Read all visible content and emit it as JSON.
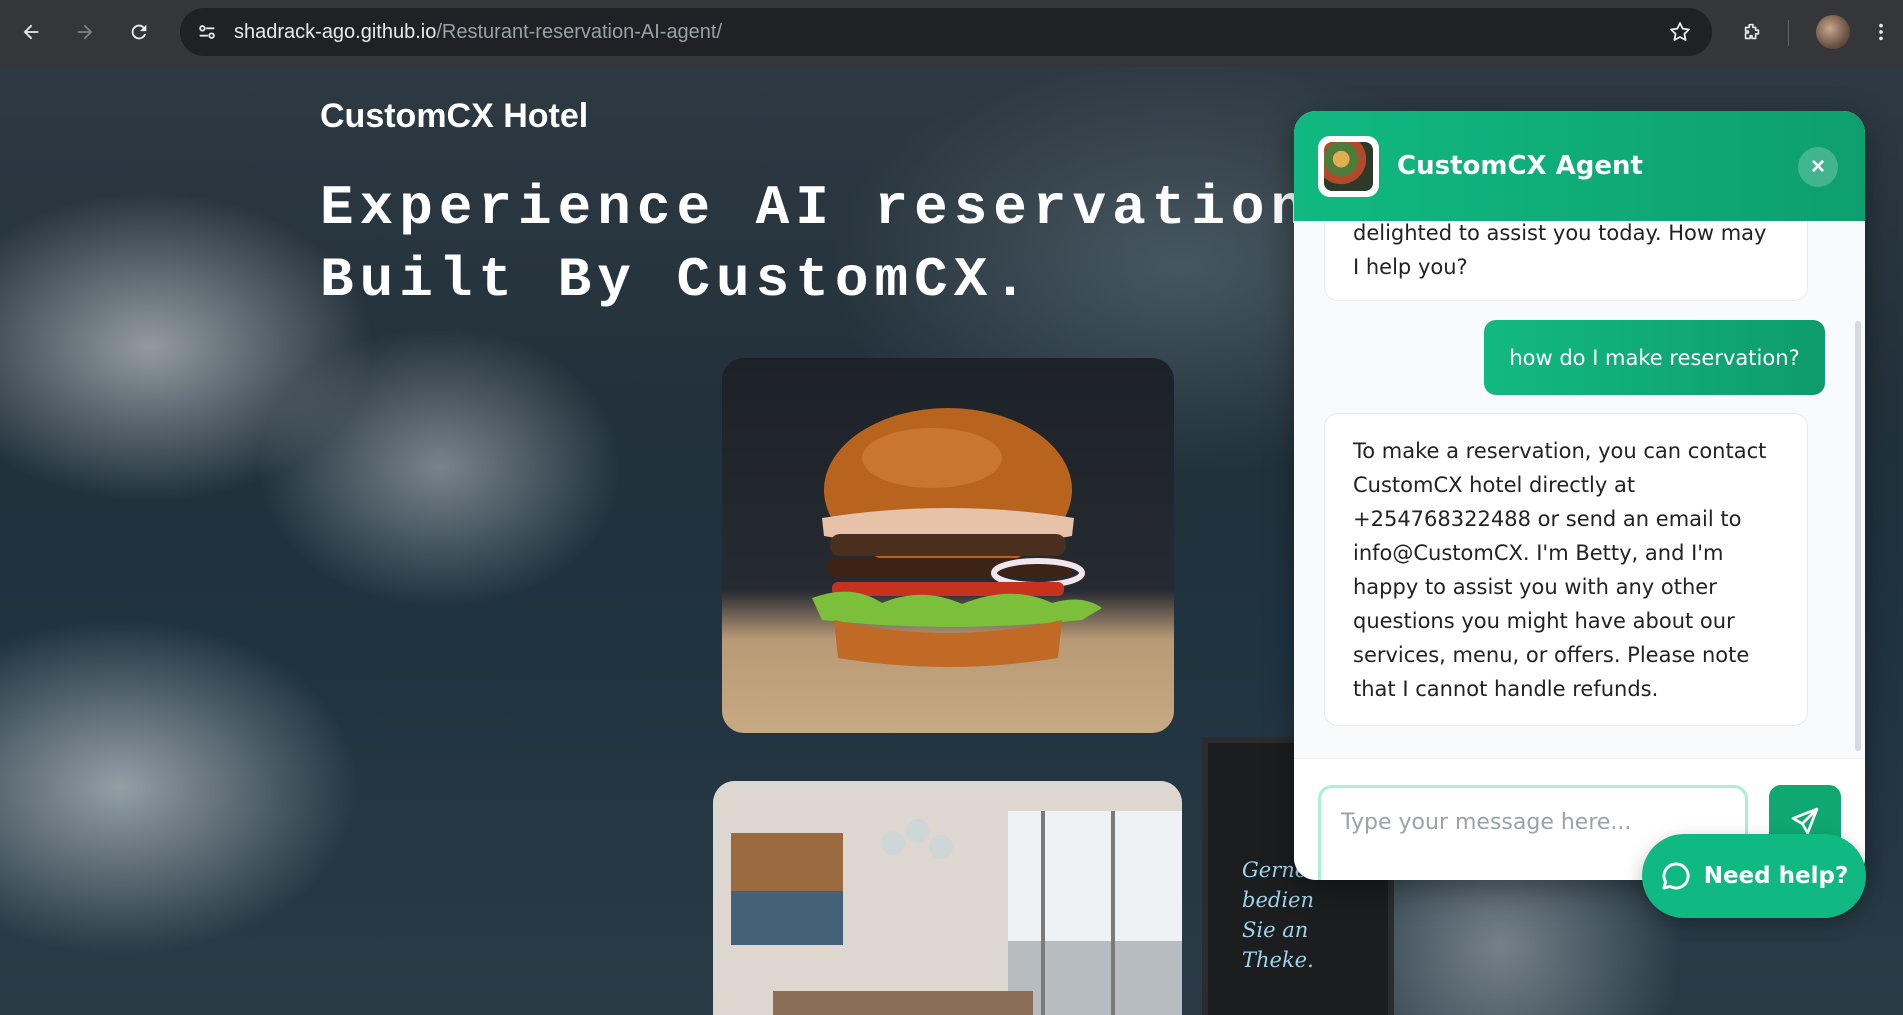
{
  "browser": {
    "url_host": "shadrack-ago.github.io",
    "url_path": "/Resturant-reservation-AI-agent/"
  },
  "page": {
    "brand": "CustomCX Hotel",
    "hero": "Experience AI reservation\nBuilt By CustomCX.",
    "board_text": "Gerne\nbedien\nSie an\nTheke."
  },
  "chat": {
    "agent_name": "CustomCX Agent",
    "close_label": "×",
    "messages": [
      {
        "role": "bot",
        "text": "delighted to assist you today. How may I help you?"
      },
      {
        "role": "user",
        "text": "how do I make reservation?"
      },
      {
        "role": "bot",
        "text": "To make a reservation, you can contact CustomCX hotel directly at +254768322488 or send an email to info@CustomCX. I'm Betty, and I'm happy to assist you with any other questions you might have about our services, menu, or offers. Please note that I cannot handle refunds."
      }
    ],
    "input_placeholder": "Type your message here...",
    "input_value": ""
  },
  "help_button": {
    "label": "Need help?"
  },
  "colors": {
    "accent": "#10b981",
    "accent_dark": "#0e9f6e",
    "chrome_bg": "#35363a",
    "omnibox_bg": "#202124"
  },
  "icons": [
    "back-arrow-icon",
    "forward-arrow-icon",
    "reload-icon",
    "site-settings-icon",
    "star-icon",
    "extensions-icon",
    "menu-dots-icon",
    "send-icon",
    "chat-bubble-icon"
  ]
}
